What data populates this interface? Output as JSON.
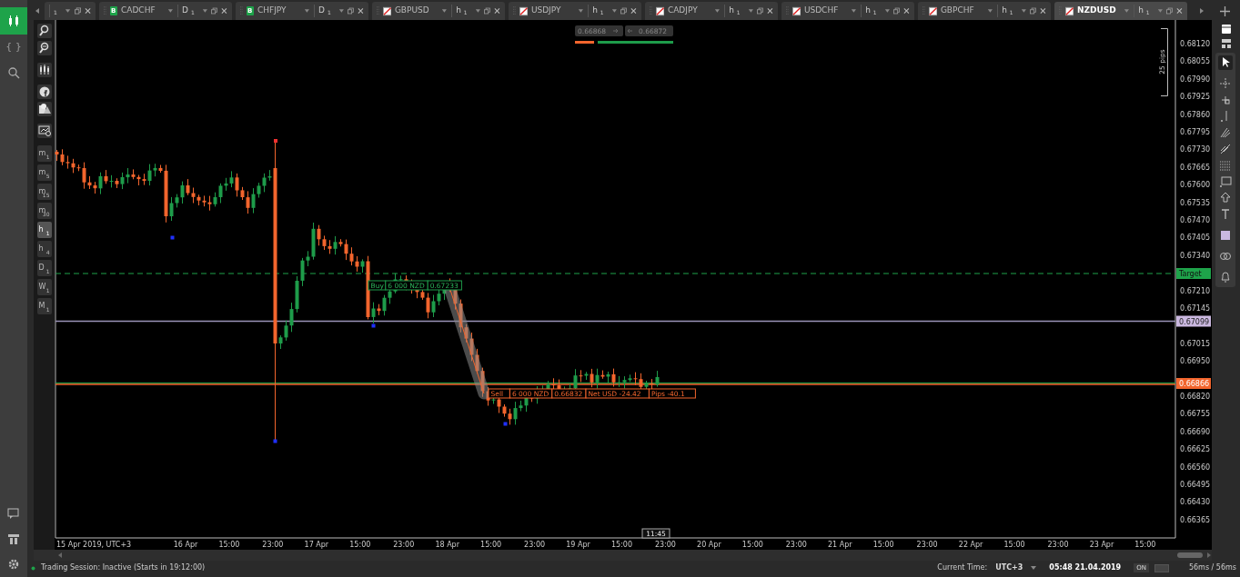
{
  "sidebar": {
    "script_label": "{ }"
  },
  "tabs": [
    {
      "kind": "partial",
      "period": "1",
      "selected": false
    },
    {
      "kind": "badge",
      "badge": "B",
      "symbol": "CADCHF",
      "timeframe": "D",
      "period": "1",
      "selected": false
    },
    {
      "kind": "badge",
      "badge": "B",
      "symbol": "CHFJPY",
      "timeframe": "D",
      "period": "1",
      "selected": false
    },
    {
      "kind": "flag",
      "symbol": "GBPUSD",
      "timeframe": "h",
      "period": "1",
      "selected": false
    },
    {
      "kind": "flag",
      "symbol": "USDJPY",
      "timeframe": "h",
      "period": "1",
      "selected": false
    },
    {
      "kind": "flag",
      "symbol": "CADJPY",
      "timeframe": "h",
      "period": "1",
      "selected": false
    },
    {
      "kind": "flag",
      "symbol": "USDCHF",
      "timeframe": "h",
      "period": "1",
      "selected": false
    },
    {
      "kind": "flag",
      "symbol": "GBPCHF",
      "timeframe": "h",
      "period": "1",
      "selected": false
    },
    {
      "kind": "flag",
      "symbol": "NZDUSD",
      "timeframe": "h",
      "period": "1",
      "selected": true
    }
  ],
  "timeframes": [
    {
      "unit": "m",
      "count": "1",
      "selected": false
    },
    {
      "unit": "m",
      "count": "5",
      "selected": false
    },
    {
      "unit": "m",
      "count": "15",
      "selected": false
    },
    {
      "unit": "m",
      "count": "30",
      "selected": false
    },
    {
      "unit": "h",
      "count": "1",
      "selected": true
    },
    {
      "unit": "h",
      "count": "4",
      "selected": false
    },
    {
      "unit": "D",
      "count": "1",
      "selected": false
    },
    {
      "unit": "W",
      "count": "1",
      "selected": false
    },
    {
      "unit": "M",
      "count": "1",
      "selected": false
    }
  ],
  "quote": {
    "sell": "0.66868",
    "buy": "0.66872"
  },
  "ruler": {
    "label": "25 pips"
  },
  "price_axis": {
    "labels": [
      "0.68120",
      "0.68055",
      "0.67990",
      "0.67925",
      "0.67860",
      "0.67795",
      "0.67730",
      "0.67665",
      "0.67600",
      "0.67535",
      "0.67470",
      "0.67405",
      "0.67340",
      "0.67210",
      "0.67145",
      "0.67015",
      "0.66950",
      "0.66820",
      "0.66755",
      "0.66690",
      "0.66625",
      "0.66560",
      "0.66495",
      "0.66430",
      "0.66365"
    ]
  },
  "markers": [
    {
      "kind": "target",
      "label": "Target"
    },
    {
      "kind": "line",
      "label": "0.67099"
    },
    {
      "kind": "bid",
      "label": "0.66866"
    }
  ],
  "trades": [
    {
      "kind": "buy",
      "parts": [
        "Buy",
        "6 000 NZD",
        "0.67233"
      ]
    },
    {
      "kind": "sell",
      "parts": [
        "Sell",
        "6 000 NZD",
        "0.66832",
        "Net USD -24.42",
        "Pips -40.1"
      ]
    }
  ],
  "time_axis": {
    "labels": [
      "15 Apr 2019, UTC+3",
      "16 Apr",
      "15:00",
      "23:00",
      "17 Apr",
      "15:00",
      "23:00",
      "18 Apr",
      "15:00",
      "23:00",
      "19 Apr",
      "15:00",
      "23:00",
      "20 Apr",
      "15:00",
      "23:00",
      "21 Apr",
      "15:00",
      "23:00",
      "22 Apr",
      "15:00",
      "23:00",
      "23 Apr",
      "15:00"
    ],
    "cursor": "11:45"
  },
  "status_bar": {
    "session": "Trading Session: Inactive (Starts in 19:12:00)",
    "current_time_label": "Current Time:",
    "timezone": "UTC+3",
    "time": "05:48 21.04.2019",
    "toggle": "ON",
    "switch_on": false,
    "latency": "56ms / 56ms"
  }
}
